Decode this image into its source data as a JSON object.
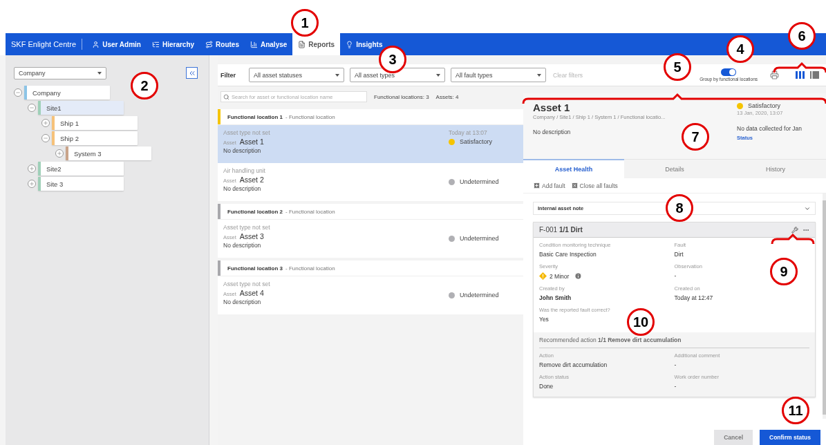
{
  "nav": {
    "brand": "SKF Enlight Centre",
    "tabs": [
      {
        "label": "User Admin",
        "selected": false
      },
      {
        "label": "Hierarchy",
        "selected": false
      },
      {
        "label": "Routes",
        "selected": false
      },
      {
        "label": "Analyse",
        "selected": false
      },
      {
        "label": "Reports",
        "selected": true
      },
      {
        "label": "Insights",
        "selected": false
      }
    ]
  },
  "sidebar": {
    "level_select": "Company",
    "tree": [
      {
        "label": "Company",
        "color": "#8cc4e6",
        "expanded": true,
        "selected": false,
        "children": [
          {
            "label": "Site1",
            "color": "#9fd0b8",
            "expanded": true,
            "selected": true,
            "children": [
              {
                "label": "Ship 1",
                "color": "#f6c27a",
                "expanded": false,
                "selected": false
              },
              {
                "label": "Ship 2",
                "color": "#f6c27a",
                "expanded": true,
                "selected": false,
                "children": [
                  {
                    "label": "System 3",
                    "color": "#c9a48a",
                    "expanded": false,
                    "selected": false
                  }
                ]
              }
            ]
          },
          {
            "label": "Site2",
            "color": "#9fd0b8",
            "expanded": false,
            "selected": false
          },
          {
            "label": "Site 3",
            "color": "#9fd0b8",
            "expanded": false,
            "selected": false
          }
        ]
      }
    ]
  },
  "filters": {
    "label": "Filter",
    "selects": [
      "All asset statuses",
      "All asset types",
      "All fault types"
    ],
    "clear": "Clear filters",
    "group_toggle": {
      "label": "Group by functional locations",
      "on": true
    },
    "view_modes": [
      {
        "selected": true
      },
      {
        "selected": false
      }
    ]
  },
  "list": {
    "search_placeholder": "Search for asset or functional location name",
    "counts": [
      "Functional locations: 3",
      "Assets: 4"
    ],
    "groups": [
      {
        "name": "Functional location 1",
        "type": "- Functional location",
        "color": "#f5c400",
        "assets": [
          {
            "type": "Asset type not set",
            "label": "Asset",
            "name": "Asset 1",
            "description": "No description",
            "date": "Today at 13:07",
            "status": "Satisfactory",
            "color": "#f5c400",
            "selected": true
          },
          {
            "type": "Air handling unit",
            "label": "Asset",
            "name": "Asset 2",
            "description": "No description",
            "status": "Undetermined",
            "color": "#b0b0b4",
            "selected": false
          }
        ]
      },
      {
        "name": "Functional location 2",
        "type": "- Functional location",
        "color": "#a8a8ac",
        "assets": [
          {
            "type": "Asset type not set",
            "label": "Asset",
            "name": "Asset 3",
            "description": "No description",
            "status": "Undetermined",
            "color": "#b0b0b4",
            "selected": false
          }
        ]
      },
      {
        "name": "Functional location 3",
        "type": "- Functional location",
        "color": "#a8a8ac",
        "assets": [
          {
            "type": "Asset type not set",
            "label": "Asset",
            "name": "Asset 4",
            "description": "No description",
            "status": "Undetermined",
            "color": "#b0b0b4",
            "selected": false
          }
        ]
      }
    ]
  },
  "detail": {
    "title": "Asset 1",
    "path": "Company / Site1 / Ship 1 / System 1 / Functional locatio...",
    "description": "No description",
    "status": "Satisfactory",
    "date": "13 Jan, 2020, 13:07",
    "note": "No data collected for Jan",
    "status_link": "Status",
    "tabs": [
      {
        "label": "Asset Health",
        "selected": true
      },
      {
        "label": "Details",
        "selected": false
      },
      {
        "label": "History",
        "selected": false
      }
    ],
    "actions": [
      "Add fault",
      "Close all faults"
    ],
    "note_select": "Internal asset note",
    "fault": {
      "title": "F-001 **1/1 Dirt**",
      "fields": [
        {
          "label": "Condition monitoring technique",
          "value": "Basic Care Inspection",
          "kind": "plain"
        },
        {
          "label": "Fault",
          "value": "Dirt",
          "kind": "plain"
        },
        {
          "label": "Severity",
          "value": "2 Minor",
          "kind": "severity"
        },
        {
          "label": "Observation",
          "value": "-",
          "kind": "plain"
        },
        {
          "label": "Created by",
          "value": "John Smith",
          "kind": "person"
        },
        {
          "label": "Created on",
          "value": "Today at 12:47",
          "kind": "plain"
        },
        {
          "label": "Was the reported fault correct?",
          "value": "Yes",
          "kind": "plain"
        }
      ],
      "action_title": "Recommended action **1/1 Remove dirt accumulation**",
      "action_fields": [
        {
          "label": "Action",
          "value": "Remove dirt accumulation",
          "kind": "plain"
        },
        {
          "label": "Additional comment",
          "value": "-",
          "kind": "plain"
        },
        {
          "label": "Action status",
          "value": "Done",
          "kind": "plain"
        },
        {
          "label": "Work order number",
          "value": "-",
          "kind": "plain"
        }
      ]
    },
    "buttons": [
      {
        "label": "Cancel",
        "disabled": true
      },
      {
        "label": "Confirm status",
        "disabled": false
      }
    ]
  },
  "callouts": [
    "1",
    "2",
    "3",
    "4",
    "5",
    "6",
    "7",
    "8",
    "9",
    "10",
    "11"
  ]
}
